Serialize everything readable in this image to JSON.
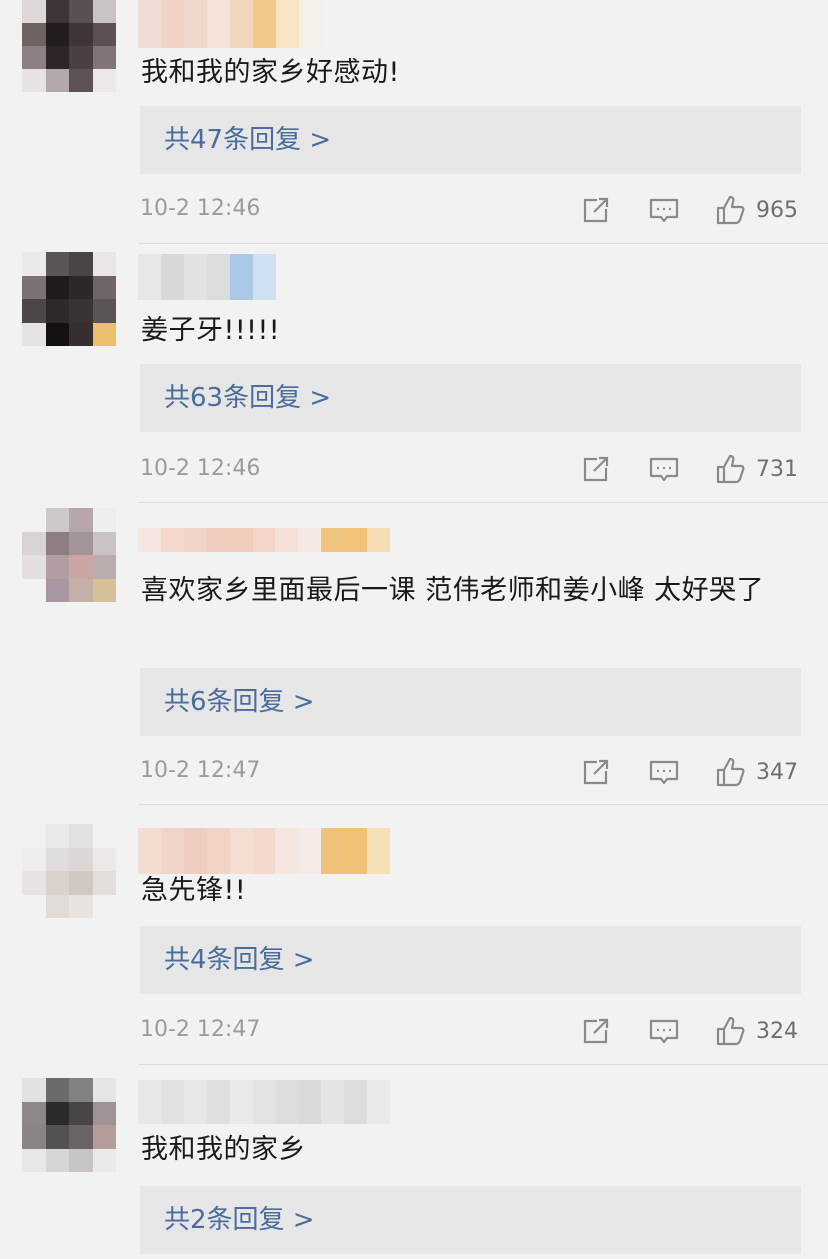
{
  "colors": {
    "background": "#f2f2f2",
    "reply_box": "#e6e6e6",
    "link": "#4a6d9c",
    "muted": "#9b9b9b"
  },
  "comments": [
    {
      "text": "我和我的家乡好感动!",
      "reply_label": "共47条回复 >",
      "time": "10-2 12:46",
      "likes": "965"
    },
    {
      "text": "姜子牙!!!!!",
      "reply_label": "共63条回复 >",
      "time": "10-2 12:46",
      "likes": "731"
    },
    {
      "text": "喜欢家乡里面最后一课 范伟老师和姜小峰 太好哭了",
      "reply_label": "共6条回复 >",
      "time": "10-2 12:47",
      "likes": "347"
    },
    {
      "text": "急先锋!!",
      "reply_label": "共4条回复 >",
      "time": "10-2 12:47",
      "likes": "324"
    },
    {
      "text": "我和我的家乡",
      "reply_label": "共2条回复 >",
      "time": "",
      "likes": ""
    }
  ],
  "icons": {
    "share": "share-icon",
    "comment": "comment-icon",
    "like": "thumbs-up-icon"
  }
}
